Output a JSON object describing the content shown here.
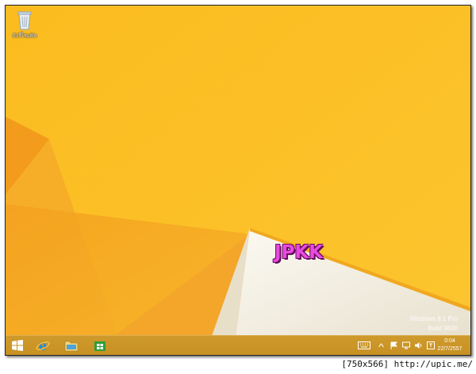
{
  "desktop": {
    "recycle_bin_label": "ถังรีไซเคิล",
    "watermark": "JPKK",
    "edition_line1": "Windows 8.1 Pro",
    "edition_line2": "Build 9600"
  },
  "colors": {
    "wallpaper_main": "#fcbd22",
    "wallpaper_shadow": "#f0a21c",
    "white_shape": "#f2eee0",
    "taskbar": "#c99326",
    "watermark_fill": "#e94be0"
  },
  "taskbar": {
    "pinned": [
      {
        "name": "start-button",
        "icon": "windows-logo-icon"
      },
      {
        "name": "internet-explorer",
        "icon": "ie-icon"
      },
      {
        "name": "file-explorer",
        "icon": "folder-icon"
      },
      {
        "name": "store",
        "icon": "store-icon"
      }
    ],
    "tray_icons": [
      "keyboard-icon",
      "chevron-up-icon",
      "flag-icon",
      "network-icon",
      "volume-icon",
      "language-icon"
    ]
  },
  "clock": {
    "time": "0:04",
    "date": "22/7/2557"
  },
  "footer": {
    "caption": "[750x566] http://upic.me/"
  }
}
